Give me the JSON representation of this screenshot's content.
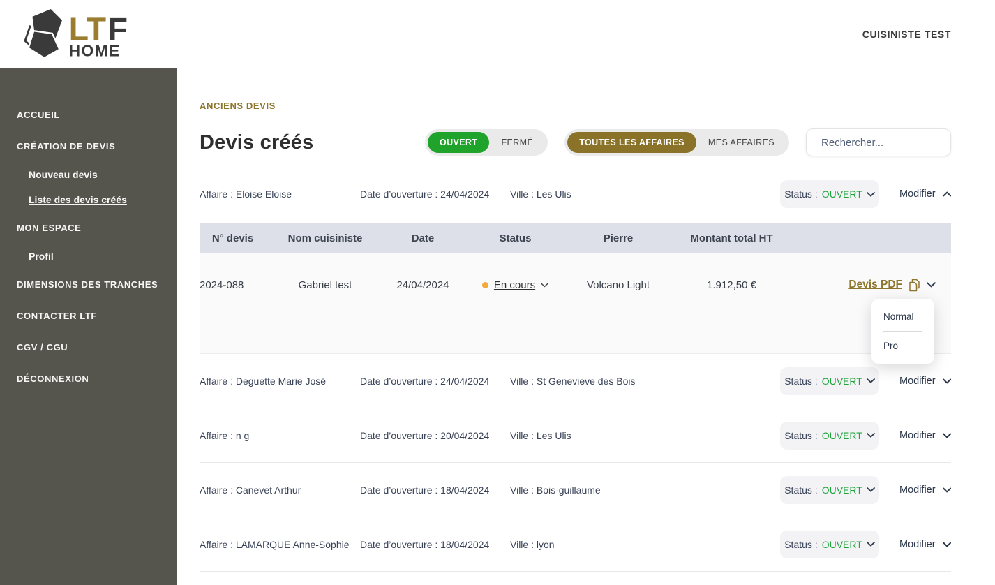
{
  "header": {
    "brand_lt": "LT",
    "brand_f": "F",
    "brand_home": "HOME",
    "user_label": "CUISINISTE TEST"
  },
  "sidebar": {
    "items": [
      {
        "label": "ACCUEIL"
      },
      {
        "label": "CRÉATION DE DEVIS"
      },
      {
        "label": "Nouveau devis"
      },
      {
        "label": "Liste des devis créés"
      },
      {
        "label": "MON ESPACE"
      },
      {
        "label": "Profil"
      },
      {
        "label": "DIMENSIONS DES TRANCHES"
      },
      {
        "label": "CONTACTER LTF"
      },
      {
        "label": "CGV / CGU"
      },
      {
        "label": "DÉCONNEXION"
      }
    ]
  },
  "main": {
    "breadcrumb": "ANCIENS DEVIS",
    "title": "Devis créés",
    "filters": {
      "status": [
        {
          "label": "OUVERT"
        },
        {
          "label": "FERMÉ"
        }
      ],
      "affaires": [
        {
          "label": "TOUTES LES AFFAIRES"
        },
        {
          "label": "MES AFFAIRES"
        }
      ],
      "search_placeholder": "Rechercher..."
    },
    "labels": {
      "modifier": "Modifier"
    },
    "affaires": [
      {
        "affaire": "Affaire : Eloise Eloise",
        "ouverture": "Date d’ouverture : 24/04/2024",
        "ville": "Ville : Les Ulis",
        "status_label": "Status :",
        "status_value": "OUVERT"
      },
      {
        "affaire": "Affaire : Deguette Marie José",
        "ouverture": "Date d’ouverture : 24/04/2024",
        "ville": "Ville : St Genevieve des Bois",
        "status_label": "Status :",
        "status_value": "OUVERT"
      },
      {
        "affaire": "Affaire : n g",
        "ouverture": "Date d’ouverture : 20/04/2024",
        "ville": "Ville : Les Ulis",
        "status_label": "Status :",
        "status_value": "OUVERT"
      },
      {
        "affaire": "Affaire : Canevet Arthur",
        "ouverture": "Date d’ouverture : 18/04/2024",
        "ville": "Ville : Bois-guillaume",
        "status_label": "Status :",
        "status_value": "OUVERT"
      },
      {
        "affaire": "Affaire : LAMARQUE Anne-Sophie",
        "ouverture": "Date d’ouverture : 18/04/2024",
        "ville": "Ville : lyon",
        "status_label": "Status :",
        "status_value": "OUVERT"
      }
    ],
    "table": {
      "headers": [
        "N° devis",
        "Nom cuisiniste",
        "Date",
        "Status",
        "Pierre",
        "Montant total HT"
      ],
      "row": {
        "num": "2024-088",
        "cuisiniste": "Gabriel test",
        "date": "24/04/2024",
        "status": "En cours",
        "pierre": "Volcano Light",
        "montant": "1.912,50 €",
        "pdf_label": "Devis PDF"
      }
    },
    "pdf_menu": {
      "items": [
        {
          "label": "Normal"
        },
        {
          "label": "Pro"
        }
      ]
    },
    "colors": {
      "gold": "#8E752C",
      "green": "#1FA32B",
      "olive": "#8A7329",
      "status_dot": "#F5A93B",
      "sidebar": "#55544D"
    }
  }
}
